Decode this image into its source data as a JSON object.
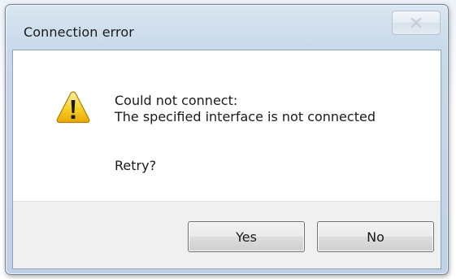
{
  "window": {
    "title": "Connection error"
  },
  "icons": {
    "warning": "warning-icon",
    "close": "close-icon"
  },
  "message": {
    "line1": "Could not connect:",
    "line2": "The specified interface is not connected",
    "question": "Retry?"
  },
  "buttons": {
    "yes_label": "Yes",
    "no_label": "No"
  },
  "colors": {
    "titlebar": "#c7d8e9",
    "warning_yellow": "#f5c400",
    "button_area": "#f0f0f0"
  }
}
